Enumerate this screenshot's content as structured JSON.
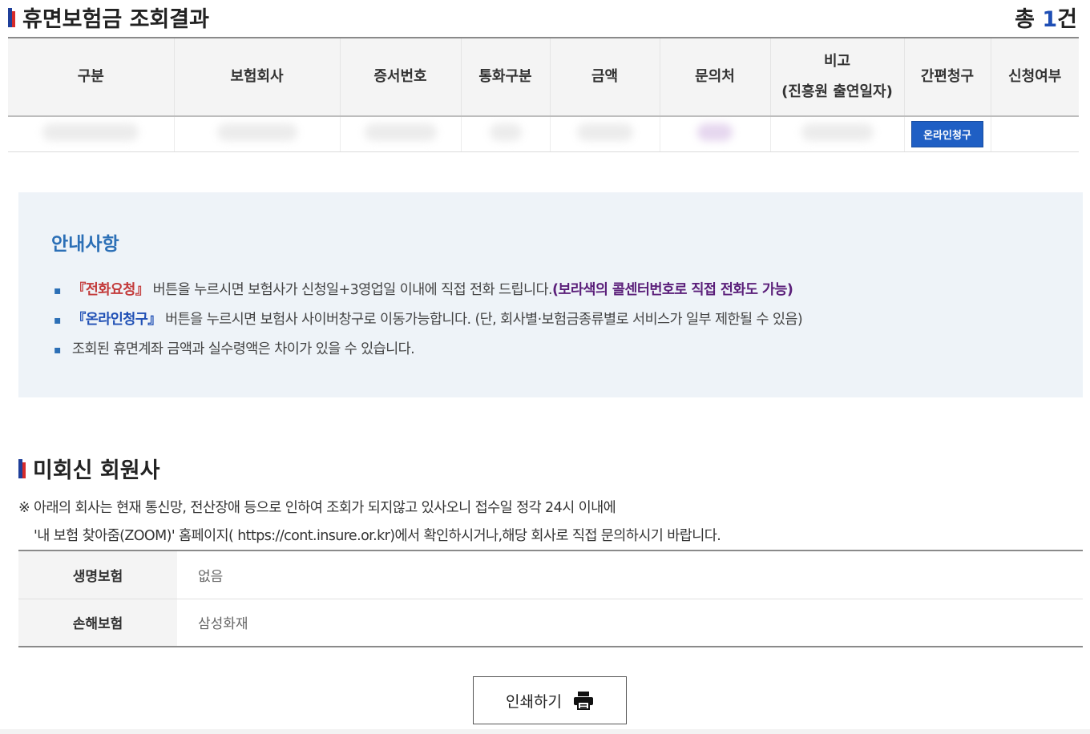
{
  "result": {
    "title": "휴면보험금 조회결과",
    "total_prefix": "총 ",
    "total_count": "1",
    "total_suffix": "건",
    "headers": [
      "구분",
      "보험회사",
      "증서번호",
      "통화구분",
      "금액",
      "문의처",
      "비고",
      "(진흥원 출연일자)",
      "간편청구",
      "신청여부"
    ],
    "online_claim_label": "온라인청구"
  },
  "guide": {
    "title": "안내사항",
    "item1_key": "『전화요청』",
    "item1_text": "버튼을 누르시면 보험사가 신청일+3영업일 이내에 직접 전화 드립니다.",
    "item1_highlight": "(보라색의 콜센터번호로 직접 전화도 가능)",
    "item2_key": "『온라인청구』",
    "item2_text": "버튼을 누르시면 보험사 사이버창구로 이동가능합니다. (단, 회사별·보험금종류별로 서비스가 일부 제한될 수 있음)",
    "item3_text": "조회된 휴면계좌 금액과 실수령액은 차이가 있을 수 있습니다."
  },
  "non_response": {
    "title": "미회신 회원사",
    "note_line1": "※ 아래의 회사는 현재 통신망, 전산장애 등으로 인하여 조회가 되지않고 있사오니 접수일 정각 24시 이내에",
    "note_line2": "'내 보험 찾아줌(ZOOM)' 홈페이지( https://cont.insure.or.kr)에서 확인하시거나,해당 회사로 직접 문의하시기 바랍니다.",
    "rows": [
      {
        "label": "생명보험",
        "value": "없음"
      },
      {
        "label": "손해보험",
        "value": "삼성화재"
      }
    ]
  },
  "print_label": "인쇄하기",
  "colors": {
    "accent_blue": "#1f4fb5",
    "guide_title": "#2b6fb6",
    "guide_bg": "#eef3f8",
    "highlight_purple": "#5b1f7a",
    "key_red": "#c33b3b"
  },
  "icons": {
    "heading_marker": "flag-bar-icon",
    "print": "printer-icon"
  }
}
